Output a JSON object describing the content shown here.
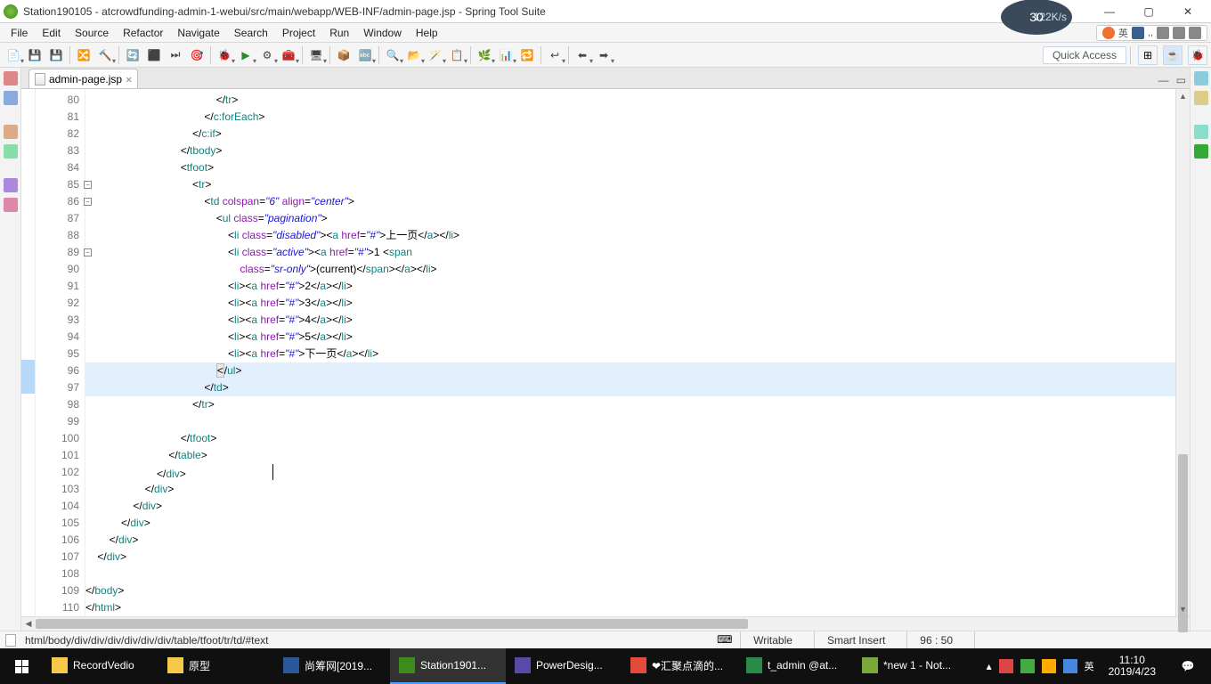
{
  "title": "Station190105 - atcrowdfunding-admin-1-webui/src/main/webapp/WEB-INF/admin-page.jsp - Spring Tool Suite",
  "net_widget": {
    "speed": "122K/s",
    "num": "30"
  },
  "menubar": [
    "File",
    "Edit",
    "Source",
    "Refactor",
    "Navigate",
    "Search",
    "Project",
    "Run",
    "Window",
    "Help"
  ],
  "ime": {
    "lang": "英"
  },
  "quick_access": "Quick Access",
  "tab": {
    "name": "admin-page.jsp",
    "close": "✕"
  },
  "gutter_start": 80,
  "gutter_end": 110,
  "fold_lines": [
    85,
    86,
    89
  ],
  "highlight_lines": [
    96,
    97
  ],
  "sel_marks": [
    96,
    97
  ],
  "code": {
    "l80": "                                            </tr>",
    "l81": "                                        </c:forEach>",
    "l82": "                                    </c:if>",
    "l83": "                                </tbody>",
    "l84": "                                <tfoot>",
    "l85": "                                    <tr>",
    "l86_a": "                                        <",
    "l86_tag": "td",
    "l86_b": " ",
    "l86_attr1": "colspan",
    "l86_eq": "=",
    "l86_v1": "\"6\"",
    "l86_sp": " ",
    "l86_attr2": "align",
    "l86_v2": "\"center\"",
    "l86_c": ">",
    "l87_a": "                                            <",
    "l87_tag": "ul",
    "l87_sp": " ",
    "l87_attr": "class",
    "l87_v": "\"pagination\"",
    "l87_b": ">",
    "l88_a": "                                                <",
    "l88_li": "li",
    "l88_sp": " ",
    "l88_attr": "class",
    "l88_v": "\"disabled\"",
    "l88_b": "><",
    "l88_a2": "a",
    "l88_sp2": " ",
    "l88_href": "href",
    "l88_hv": "\"#\"",
    "l88_c": ">",
    "l88_txt": "上一页",
    "l88_d": "</",
    "l88_e": "></",
    "l88_f": ">",
    "l89_a": "                                                <",
    "l89_li": "li",
    "l89_sp": " ",
    "l89_attr": "class",
    "l89_v": "\"active\"",
    "l89_b": "><",
    "l89_a2": "a",
    "l89_sp2": " ",
    "l89_href": "href",
    "l89_hv": "\"#\"",
    "l89_c": ">",
    "l89_txt": "1 ",
    "l89_d": "<",
    "l89_span": "span",
    "l90_a": "                                                    ",
    "l90_attr": "class",
    "l90_v": "\"sr-only\"",
    "l90_b": ">",
    "l90_txt": "(current)",
    "l90_c": "</",
    "l90_span": "span",
    "l90_d": "></",
    "l90_a2": "a",
    "l90_e": "></",
    "l90_li": "li",
    "l90_f": ">",
    "l91_a": "                                                <",
    "l91_li": "li",
    "l91_b": "><",
    "l91_a2": "a",
    "l91_sp": " ",
    "l91_href": "href",
    "l91_hv": "\"#\"",
    "l91_c": ">",
    "l91_txt": "2",
    "l91_d": "</",
    "l91_e": "></",
    "l91_f": ">",
    "l92_txt": "3",
    "l93_txt": "4",
    "l94_txt": "5",
    "l95_txt": "下一页",
    "l96_a": "                                            ",
    "l96_box": "<",
    "l96_b": "/",
    "l96_ul": "ul",
    "l96_c": ">",
    "l97": "                                        </td>",
    "l98": "                                    </tr>",
    "l99": "",
    "l100": "                                </tfoot>",
    "l101": "                            </table>",
    "l102": "                        </div>",
    "l103": "                    </div>",
    "l104": "                </div>",
    "l105": "            </div>",
    "l106": "        </div>",
    "l107": "    </div>",
    "l108": "",
    "l109": "</body>",
    "l110": "</html>"
  },
  "cursor_pos_line": 102,
  "breadcrumb": "html/body/div/div/div/div/div/div/table/tfoot/tr/td/#text",
  "status": {
    "writable": "Writable",
    "insert": "Smart Insert",
    "pos": "96 : 50"
  },
  "taskbar": {
    "items": [
      {
        "label": "RecordVedio",
        "color": "#f7c948"
      },
      {
        "label": "原型",
        "color": "#f7c948"
      },
      {
        "label": "尚筹网[2019...",
        "color": "#2b579a"
      },
      {
        "label": "Station1901...",
        "color": "#3d8b1a",
        "active": true
      },
      {
        "label": "PowerDesig...",
        "color": "#5a4aa8"
      },
      {
        "label": "❤汇聚点滴的...",
        "color": "#e24a3b"
      },
      {
        "label": "t_admin @at...",
        "color": "#2a8a4a"
      },
      {
        "label": "*new 1 - Not...",
        "color": "#7aa83a"
      }
    ],
    "chevron": "▴",
    "clock_time": "11:10",
    "clock_date": "2019/4/23"
  }
}
